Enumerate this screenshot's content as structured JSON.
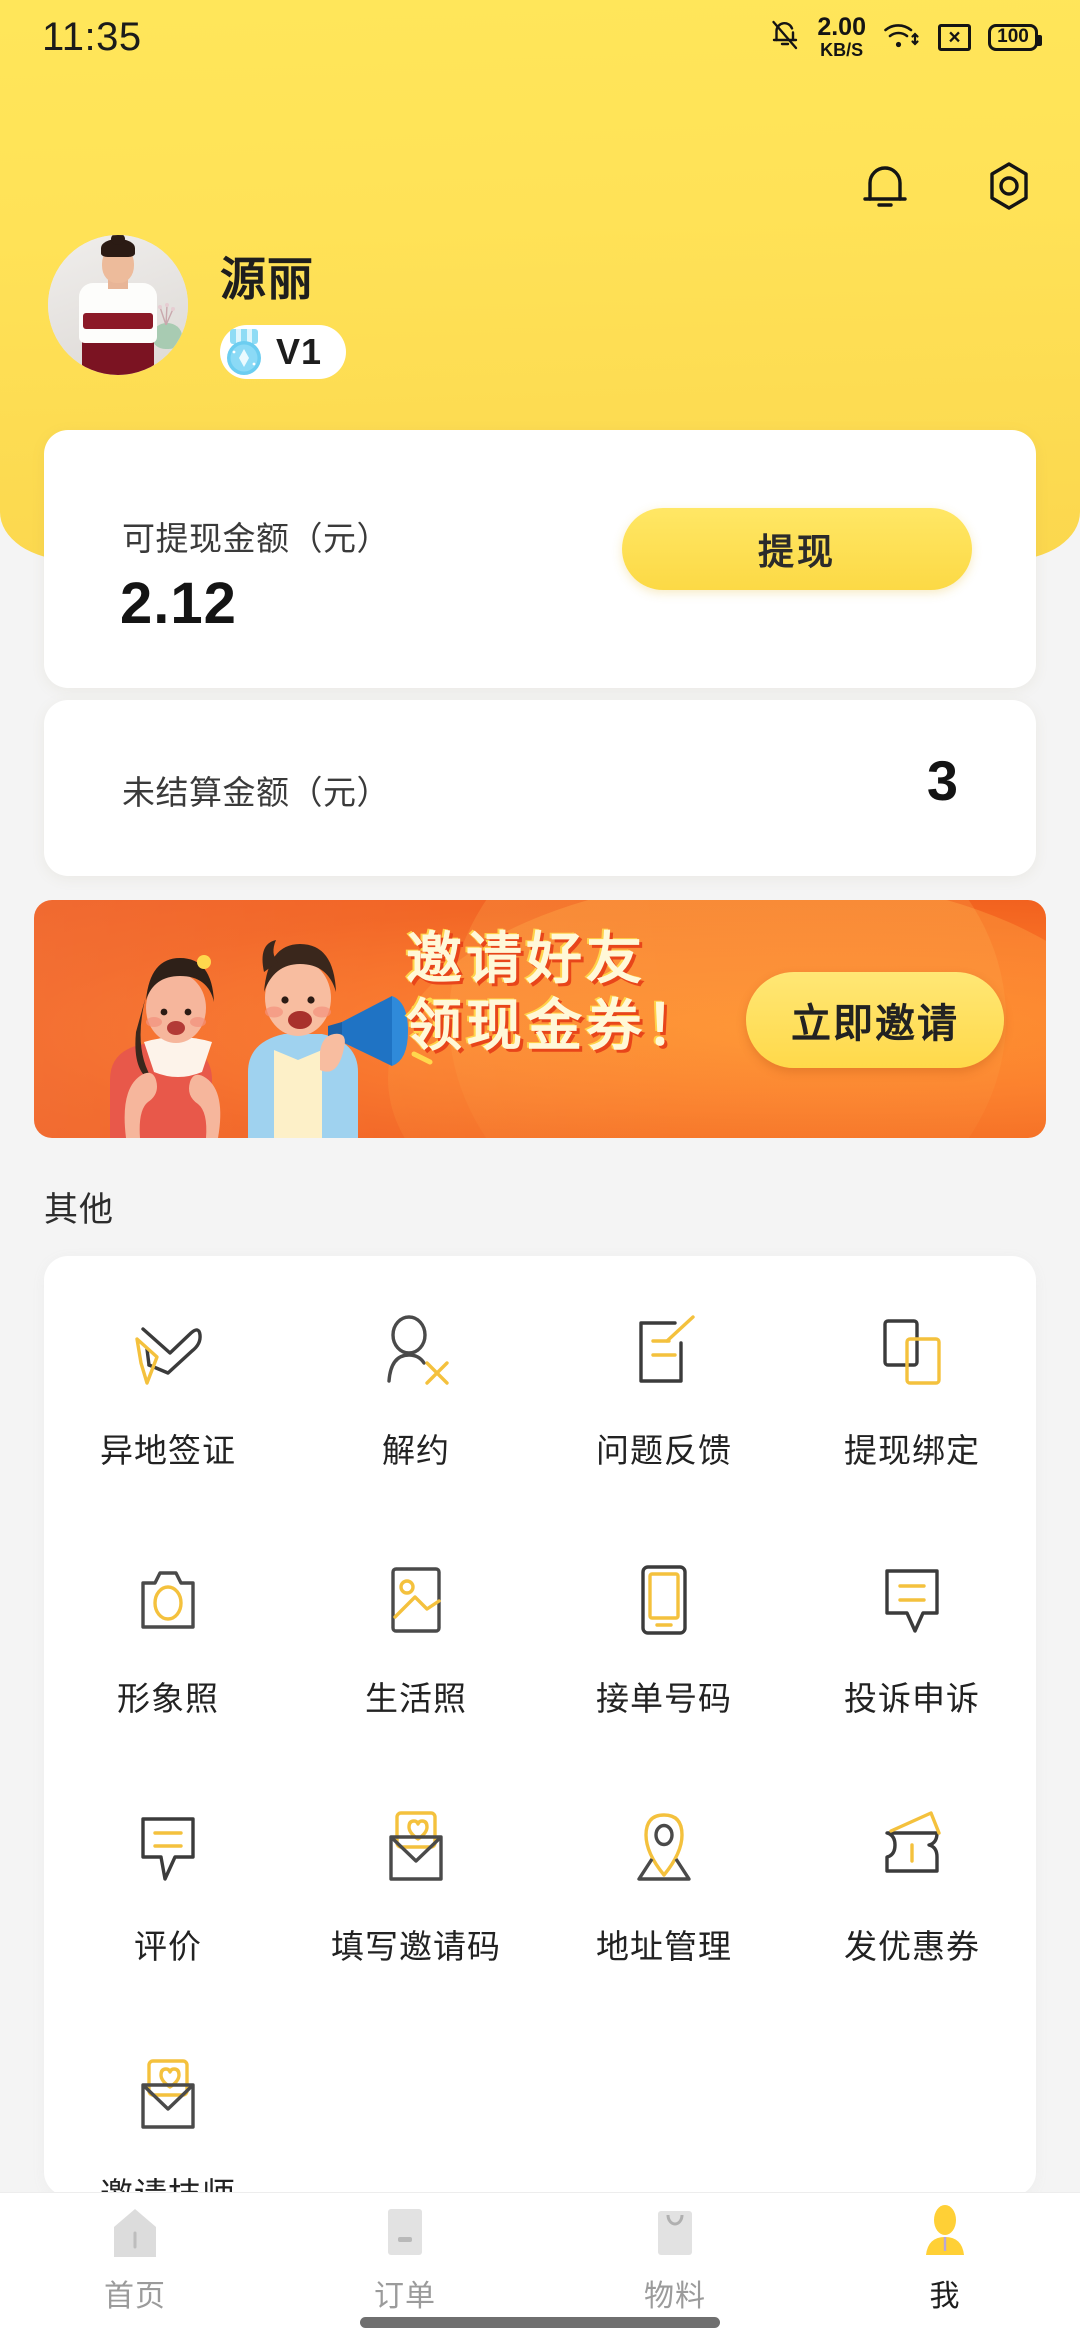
{
  "statusbar": {
    "time": "11:35",
    "net_speed_value": "2.00",
    "net_speed_unit": "KB/S",
    "battery": "100",
    "icons": [
      "bell-off-icon",
      "wifi-icon",
      "sim-no-signal-icon",
      "battery-icon"
    ]
  },
  "header": {
    "accent_yellow": "#ffe65a",
    "notification_icon": "bell-icon",
    "settings_icon": "gear-hexagon-icon",
    "profile": {
      "username": "源丽",
      "level_badge": "V1",
      "badge_icon": "medal-icon",
      "avatar_icon": "avatar-photo"
    }
  },
  "balance_card": {
    "label": "可提现金额（元）",
    "value": "2.12",
    "withdraw_button": "提现"
  },
  "unsettled_card": {
    "label": "未结算金额（元）",
    "value": "3"
  },
  "banner": {
    "title_line1": "邀请好友",
    "title_line2": "领现金券！",
    "button": "立即邀请",
    "bg_color": "#f2621f",
    "button_color": "#ffd94a"
  },
  "other_section": {
    "title": "其他",
    "items": [
      {
        "label": "异地签证",
        "icon": "airplane-icon"
      },
      {
        "label": "解约",
        "icon": "person-cancel-icon"
      },
      {
        "label": "问题反馈",
        "icon": "document-edit-icon"
      },
      {
        "label": "提现绑定",
        "icon": "cards-bind-icon"
      },
      {
        "label": "形象照",
        "icon": "camera-icon"
      },
      {
        "label": "生活照",
        "icon": "photo-image-icon"
      },
      {
        "label": "接单号码",
        "icon": "phone-icon"
      },
      {
        "label": "投诉申诉",
        "icon": "speech-bubble-icon"
      },
      {
        "label": "评价",
        "icon": "speech-bubble-icon"
      },
      {
        "label": "填写邀请码",
        "icon": "envelope-heart-icon"
      },
      {
        "label": "地址管理",
        "icon": "location-pin-icon"
      },
      {
        "label": "发优惠券",
        "icon": "coupon-icon"
      },
      {
        "label": "邀请技师",
        "icon": "envelope-heart-icon"
      }
    ]
  },
  "tabbar": {
    "active_index": 3,
    "items": [
      {
        "label": "首页",
        "icon": "home-icon"
      },
      {
        "label": "订单",
        "icon": "order-icon"
      },
      {
        "label": "物料",
        "icon": "material-icon"
      },
      {
        "label": "我",
        "icon": "profile-icon"
      }
    ]
  }
}
